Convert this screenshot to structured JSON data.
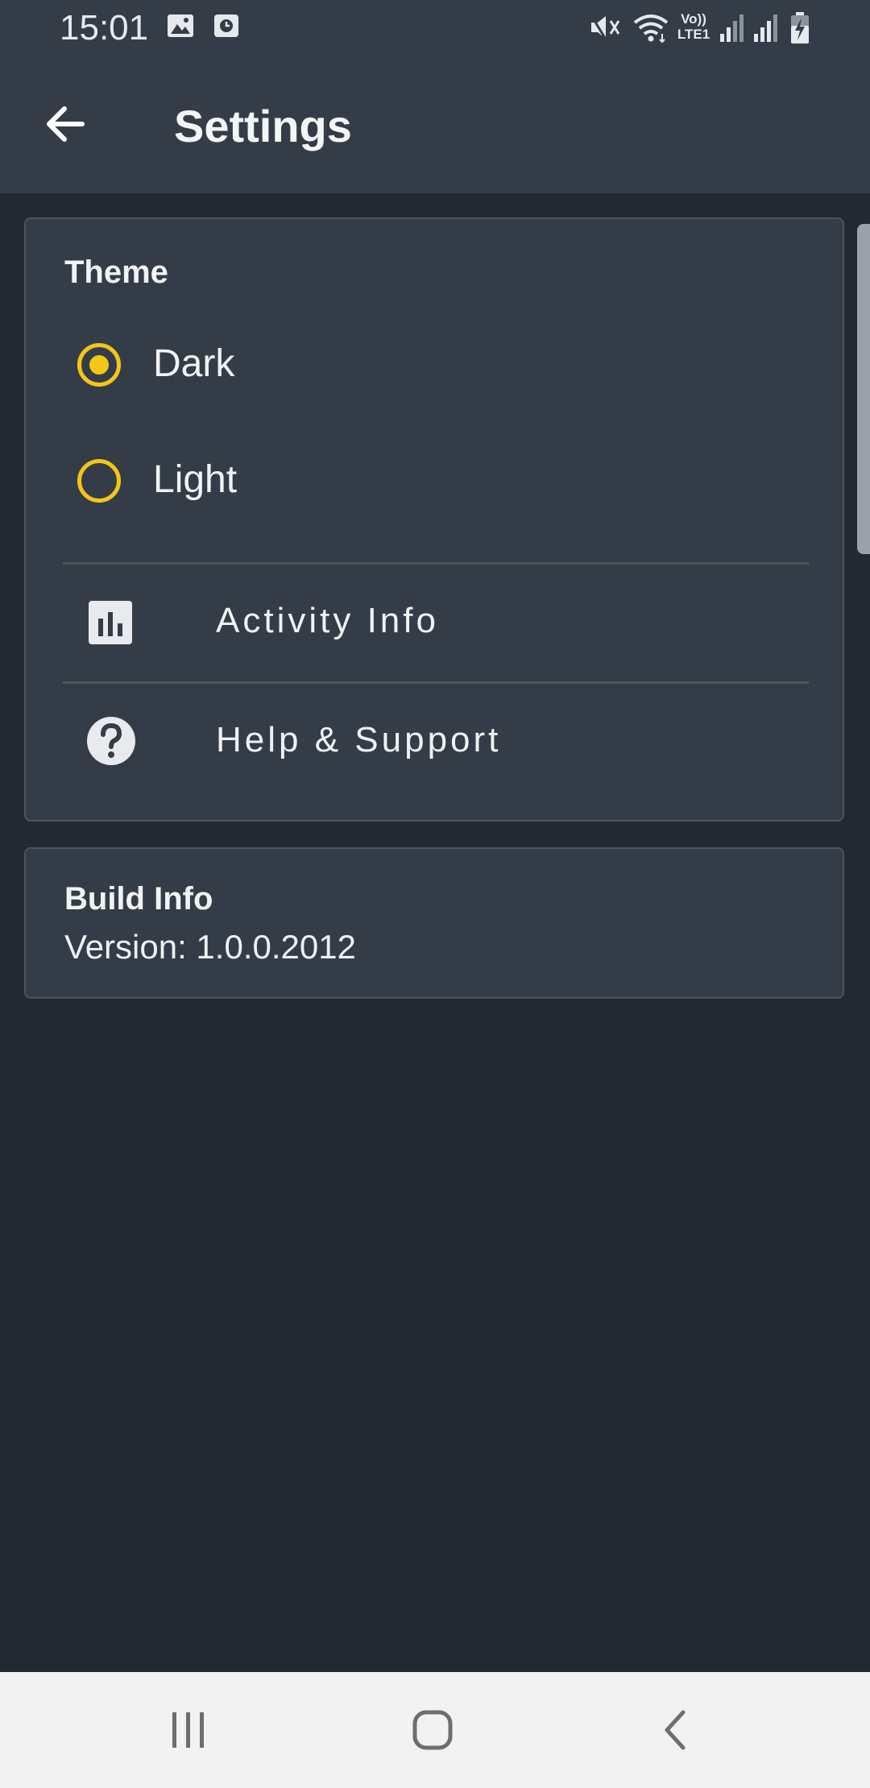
{
  "status_bar": {
    "time": "15:01",
    "left_icons": [
      "image-icon",
      "clock-icon"
    ],
    "right_icons": [
      "mute-icon",
      "wifi-icon",
      "volte-icon",
      "signal-icon",
      "signal-icon",
      "battery-charging-icon"
    ],
    "volte_label_top": "Vo))",
    "volte_label_bottom": "LTE1"
  },
  "app_bar": {
    "title": "Settings",
    "back_icon": "arrow-left-icon"
  },
  "theme_section": {
    "title": "Theme",
    "options": [
      {
        "label": "Dark",
        "selected": true
      },
      {
        "label": "Light",
        "selected": false
      }
    ]
  },
  "menu": [
    {
      "label": "Activity Info",
      "icon": "bar-chart-icon"
    },
    {
      "label": "Help & Support",
      "icon": "help-circle-icon"
    }
  ],
  "build_info": {
    "title": "Build Info",
    "version": "Version: 1.0.0.2012"
  },
  "nav_bar": {
    "icons": [
      "recent-apps-icon",
      "home-icon",
      "back-icon"
    ]
  },
  "colors": {
    "background": "#232930",
    "surface": "#343d47",
    "accent": "#f5c518",
    "text": "#f2f3f4"
  }
}
